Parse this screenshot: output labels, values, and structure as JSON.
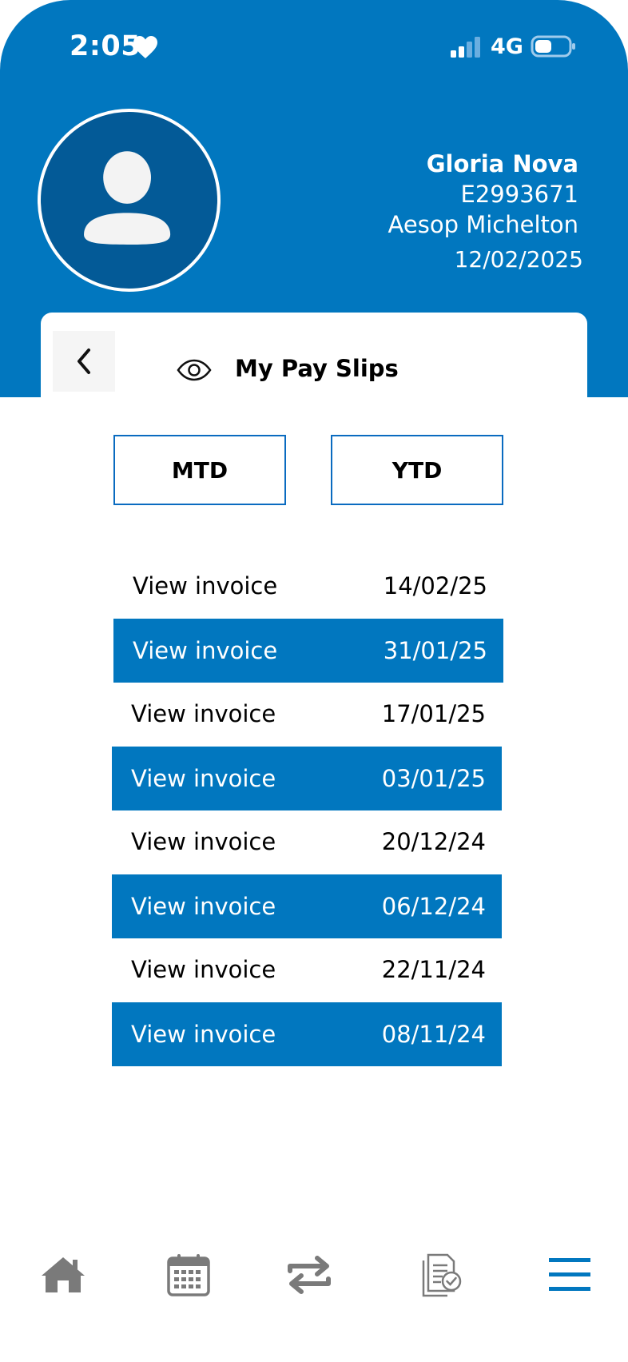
{
  "status_bar": {
    "time": "2:05",
    "network": "4G"
  },
  "profile": {
    "name": "Gloria Nova",
    "employee_id": "E2993671",
    "company": "Aesop Michelton",
    "date": "12/02/2025"
  },
  "page": {
    "title": "My Pay Slips"
  },
  "tabs": {
    "mtd": "MTD",
    "ytd": "YTD"
  },
  "invoices": [
    {
      "label": "View invoice",
      "date": "14/02/25"
    },
    {
      "label": "View invoice",
      "date": "31/01/25"
    },
    {
      "label": "View invoice",
      "date": "17/01/25"
    },
    {
      "label": "View invoice",
      "date": "03/01/25"
    },
    {
      "label": "View invoice",
      "date": "20/12/24"
    },
    {
      "label": "View invoice",
      "date": "06/12/24"
    },
    {
      "label": "View invoice",
      "date": "22/11/24"
    },
    {
      "label": "View invoice",
      "date": "08/11/24"
    }
  ],
  "bottom_nav": [
    "home-icon",
    "calendar-icon",
    "transfer-icon",
    "document-check-icon",
    "menu-icon"
  ],
  "colors": {
    "primary": "#0177bf",
    "avatar_bg": "#035a97",
    "nav_icon": "#707070"
  }
}
